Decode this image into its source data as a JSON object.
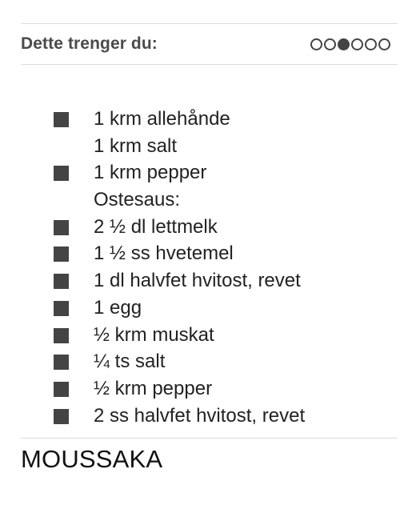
{
  "header": {
    "title": "Dette trenger du:",
    "pager": {
      "total": 6,
      "active_index": 2
    }
  },
  "ingredients": [
    {
      "text": "1 krm allehånde",
      "bullet": true
    },
    {
      "text": "1 krm salt",
      "bullet": false
    },
    {
      "text": "1 krm pepper",
      "bullet": true
    },
    {
      "text": "Ostesaus:",
      "bullet": false
    },
    {
      "text": "2 ½ dl lettmelk",
      "bullet": true
    },
    {
      "text": "1 ½ ss hvetemel",
      "bullet": true
    },
    {
      "text": "1 dl halvfet hvitost, revet",
      "bullet": true
    },
    {
      "text": "1 egg",
      "bullet": true
    },
    {
      "text": "½ krm muskat",
      "bullet": true
    },
    {
      "text": "¼ ts salt",
      "bullet": true
    },
    {
      "text": "½ krm pepper",
      "bullet": true
    },
    {
      "text": "2 ss halvfet hvitost, revet",
      "bullet": true
    }
  ],
  "recipe": {
    "title": "MOUSSAKA"
  },
  "colors": {
    "bullet": "#444444",
    "rule": "#dcdcdc",
    "text": "#222222"
  }
}
